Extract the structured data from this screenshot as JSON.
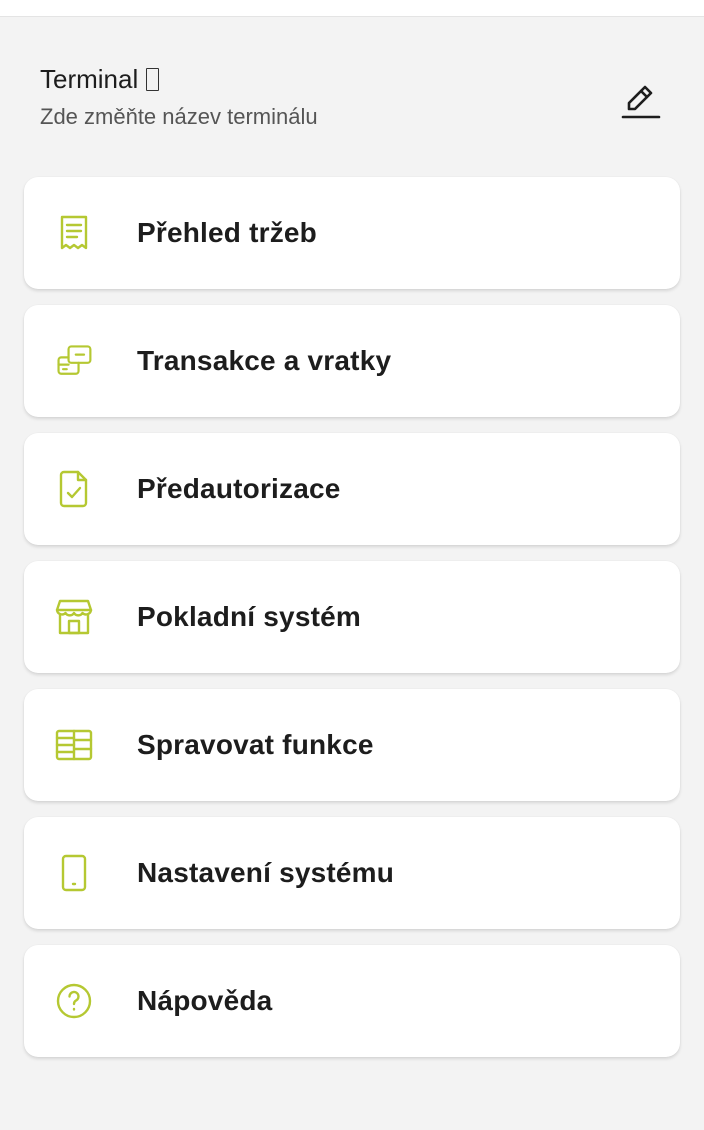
{
  "colors": {
    "background": "#f3f3f3",
    "card": "#ffffff",
    "accent": "#b5c832",
    "text": "#1d1d1d",
    "subtext": "#555555"
  },
  "header": {
    "title": "Terminal",
    "subtitle": "Zde změňte název terminálu",
    "edit_icon": "pencil-icon"
  },
  "menu": {
    "items": [
      {
        "label": "Přehled tržeb",
        "icon": "receipt-icon"
      },
      {
        "label": "Transakce a vratky",
        "icon": "card-transfer-icon"
      },
      {
        "label": "Předautorizace",
        "icon": "document-check-icon"
      },
      {
        "label": "Pokladní systém",
        "icon": "store-icon"
      },
      {
        "label": "Spravovat funkce",
        "icon": "modules-icon"
      },
      {
        "label": "Nastavení systému",
        "icon": "phone-icon"
      },
      {
        "label": "Nápověda",
        "icon": "help-circle-icon"
      }
    ]
  }
}
